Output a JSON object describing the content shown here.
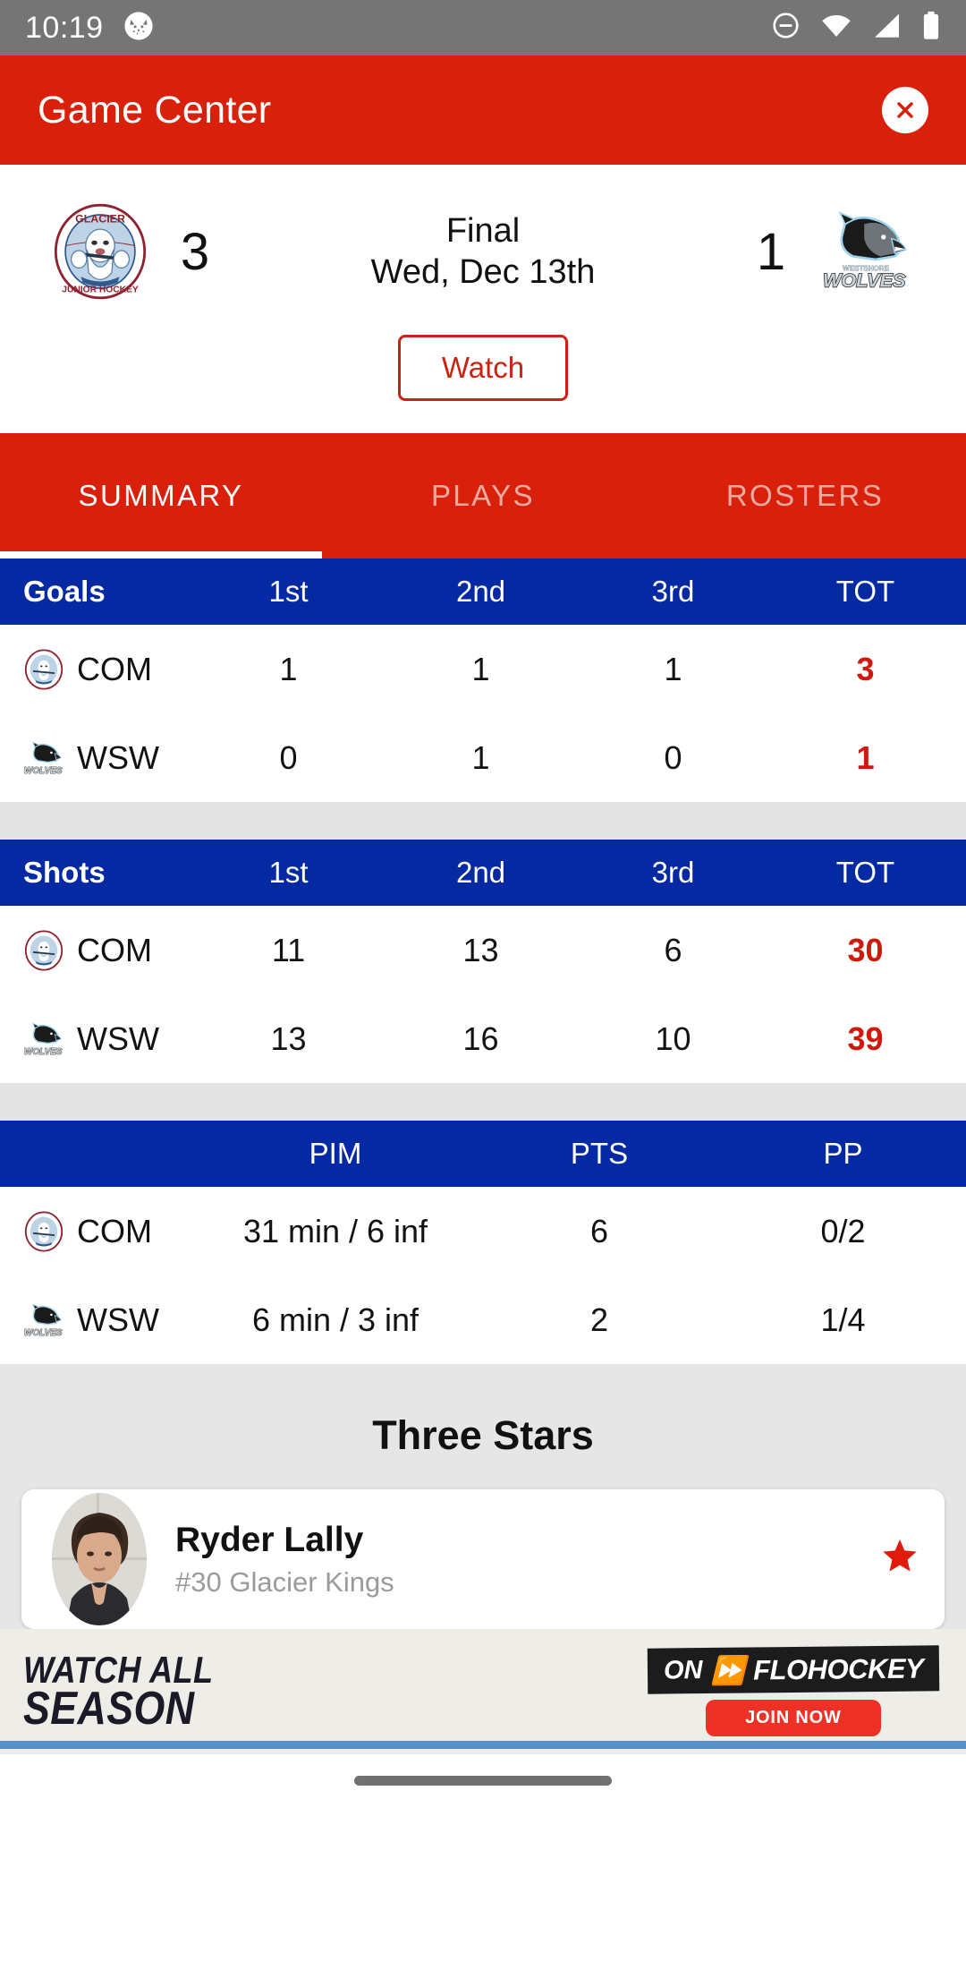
{
  "status_bar": {
    "time": "10:19",
    "notification_icon": "cat-face-icon",
    "icons": [
      "do-not-disturb-icon",
      "wifi-icon",
      "cellular-signal-icon",
      "battery-icon"
    ]
  },
  "app_bar": {
    "title": "Game Center",
    "close_icon": "close-icon"
  },
  "scoreboard": {
    "home_team": {
      "name": "Glacier Kings",
      "abbr": "COM",
      "score": "3",
      "logo": "glacier-kings-logo"
    },
    "away_team": {
      "name": "Westshore Wolves",
      "abbr": "WSW",
      "score": "1",
      "logo": "westshore-wolves-logo"
    },
    "status": "Final",
    "date": "Wed, Dec 13th",
    "watch_label": "Watch"
  },
  "tabs": [
    {
      "label": "SUMMARY",
      "active": true
    },
    {
      "label": "PLAYS",
      "active": false
    },
    {
      "label": "ROSTERS",
      "active": false
    }
  ],
  "goals_table": {
    "title": "Goals",
    "columns": [
      "1st",
      "2nd",
      "3rd",
      "TOT"
    ],
    "rows": [
      {
        "abbr": "COM",
        "logo": "glacier-kings-logo",
        "values": [
          "1",
          "1",
          "1"
        ],
        "total": "3"
      },
      {
        "abbr": "WSW",
        "logo": "westshore-wolves-logo",
        "values": [
          "0",
          "1",
          "0"
        ],
        "total": "1"
      }
    ]
  },
  "shots_table": {
    "title": "Shots",
    "columns": [
      "1st",
      "2nd",
      "3rd",
      "TOT"
    ],
    "rows": [
      {
        "abbr": "COM",
        "logo": "glacier-kings-logo",
        "values": [
          "11",
          "13",
          "6"
        ],
        "total": "30"
      },
      {
        "abbr": "WSW",
        "logo": "westshore-wolves-logo",
        "values": [
          "13",
          "16",
          "10"
        ],
        "total": "39"
      }
    ]
  },
  "penalty_table": {
    "title": "",
    "columns": [
      "PIM",
      "PTS",
      "PP"
    ],
    "rows": [
      {
        "abbr": "COM",
        "logo": "glacier-kings-logo",
        "pim": "31 min / 6 inf",
        "pts": "6",
        "pp": "0/2"
      },
      {
        "abbr": "WSW",
        "logo": "westshore-wolves-logo",
        "pim": "6 min / 3 inf",
        "pts": "2",
        "pp": "1/4"
      }
    ]
  },
  "three_stars": {
    "title": "Three Stars",
    "players": [
      {
        "name": "Ryder Lally",
        "detail": "#30 Glacier Kings",
        "star_icon": "star-icon",
        "avatar": "player-photo"
      }
    ]
  },
  "ad": {
    "line1": "WATCH ALL",
    "line2": "SEASON",
    "on_label": "ON",
    "brand": "FLOHOCKEY",
    "cta": "JOIN NOW"
  },
  "colors": {
    "brand_red": "#D8200A",
    "table_blue": "#0529A3",
    "total_red": "#D0190B",
    "status_gray": "#757575",
    "page_gray": "#E6E6E6"
  }
}
